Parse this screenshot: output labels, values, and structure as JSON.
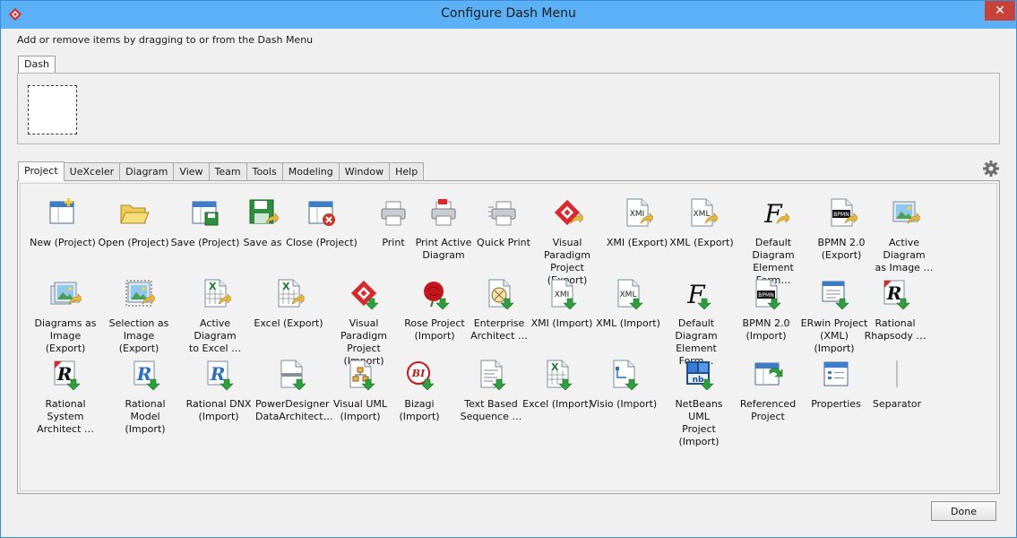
{
  "window": {
    "title": "Configure Dash Menu",
    "close_glyph": "✕"
  },
  "instruction": "Add or remove items by dragging to or from the Dash Menu",
  "dash": {
    "tab_label": "Dash"
  },
  "tabs": [
    "Project",
    "UeXceler",
    "Diagram",
    "View",
    "Team",
    "Tools",
    "Modeling",
    "Window",
    "Help"
  ],
  "active_tab": "Project",
  "items": [
    {
      "label": "New (Project)",
      "icon": "new-project-icon"
    },
    {
      "label": "Open (Project)",
      "icon": "open-project-icon"
    },
    {
      "label": "Save (Project)",
      "icon": "save-project-icon"
    },
    {
      "label": "Save as",
      "icon": "save-as-icon"
    },
    {
      "label": "Close (Project)",
      "icon": "close-project-icon"
    },
    {
      "label": "Print",
      "icon": "print-icon"
    },
    {
      "label": "Print Active\nDiagram",
      "icon": "print-diagram-icon"
    },
    {
      "label": "Quick Print",
      "icon": "quick-print-icon"
    },
    {
      "label": "Visual Paradigm\nProject (Export)",
      "icon": "vp-export-icon"
    },
    {
      "label": "XMI (Export)",
      "icon": "xmi-export-icon"
    },
    {
      "label": "XML (Export)",
      "icon": "xml-export-icon"
    },
    {
      "label": "Default Diagram\nElement Form…",
      "icon": "default-diagram-export-icon"
    },
    {
      "label": "BPMN 2.0\n(Export)",
      "icon": "bpmn-export-icon"
    },
    {
      "label": "Active Diagram\nas Image …",
      "icon": "diagram-image-icon"
    },
    {
      "label": "Diagrams as\nImage (Export)",
      "icon": "diagrams-image-icon"
    },
    {
      "label": "Selection as\nImage (Export)",
      "icon": "selection-image-icon"
    },
    {
      "label": "Active Diagram\nto Excel …",
      "icon": "diagram-excel-icon"
    },
    {
      "label": "Excel (Export)",
      "icon": "excel-export-icon"
    },
    {
      "label": "Visual Paradigm\nProject (Import)",
      "icon": "vp-import-icon"
    },
    {
      "label": "Rose Project\n(Import)",
      "icon": "rose-import-icon"
    },
    {
      "label": "Enterprise\nArchitect …",
      "icon": "enterprise-architect-icon"
    },
    {
      "label": "XMI (Import)",
      "icon": "xmi-import-icon"
    },
    {
      "label": "XML (Import)",
      "icon": "xml-import-icon"
    },
    {
      "label": "Default Diagram\nElement Form…",
      "icon": "default-diagram-import-icon"
    },
    {
      "label": "BPMN 2.0\n(Import)",
      "icon": "bpmn-import-icon"
    },
    {
      "label": "ERwin Project\n(XML) (Import)",
      "icon": "erwin-import-icon"
    },
    {
      "label": "Rational\nRhapsody …",
      "icon": "rhapsody-icon"
    },
    {
      "label": "Rational System\nArchitect …",
      "icon": "system-architect-icon"
    },
    {
      "label": "Rational Model\n(Import)",
      "icon": "rational-model-icon"
    },
    {
      "label": "Rational DNX\n(Import)",
      "icon": "rational-dnx-icon"
    },
    {
      "label": "PowerDesigner\nDataArchitect…",
      "icon": "powerdesigner-icon"
    },
    {
      "label": "Visual UML\n(Import)",
      "icon": "visual-uml-icon"
    },
    {
      "label": "Bizagi (Import)",
      "icon": "bizagi-icon"
    },
    {
      "label": "Text Based\nSequence …",
      "icon": "text-sequence-icon"
    },
    {
      "label": "Excel (Import)",
      "icon": "excel-import-icon"
    },
    {
      "label": "Visio (Import)",
      "icon": "visio-import-icon"
    },
    {
      "label": "NetBeans UML\nProject (Import)",
      "icon": "netbeans-import-icon"
    },
    {
      "label": "Referenced\nProject",
      "icon": "referenced-project-icon"
    },
    {
      "label": "Properties",
      "icon": "properties-icon"
    },
    {
      "label": "Separator",
      "icon": "separator-icon"
    }
  ],
  "colors": {
    "titlebar": "#5cb0f5",
    "close": "#c7433a",
    "vp_red": "#d8292f",
    "excel_green": "#1e7a2e",
    "arrow_yellow": "#e8b83a"
  },
  "done_label": "Done"
}
